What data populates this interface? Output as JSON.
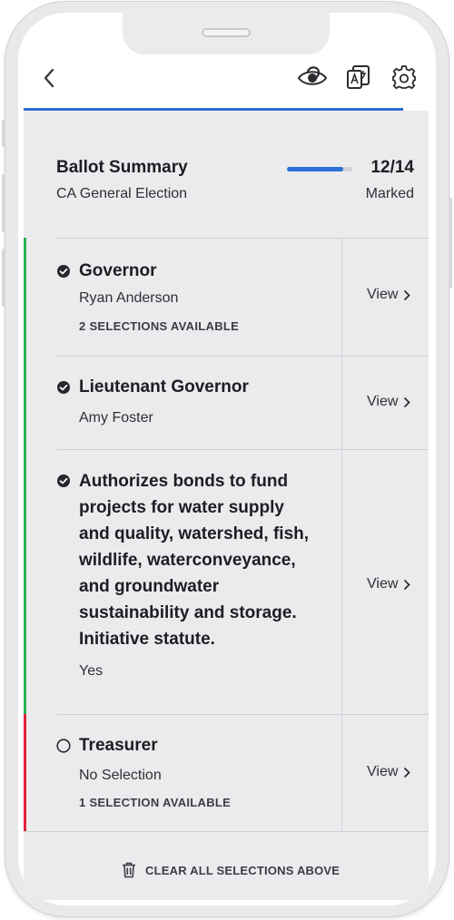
{
  "summary": {
    "title": "Ballot Summary",
    "election": "CA General Election",
    "count": "12/14",
    "marked_label": "Marked",
    "progress": 0.857
  },
  "contests": [
    {
      "title": "Governor",
      "selection": "Ryan Anderson",
      "availability": "2 SELECTIONS AVAILABLE",
      "status": "complete",
      "bar_color": "#27b350",
      "view_label": "View"
    },
    {
      "title": "Lieutenant Governor",
      "selection": "Amy Foster",
      "availability": "",
      "status": "complete",
      "bar_color": "#27b350",
      "view_label": "View"
    },
    {
      "title": "Authorizes bonds to fund projects for water supply and quality, watershed, fish, wildlife, waterconveyance, and groundwater sustainability and storage. Initiative statute.",
      "selection": "Yes",
      "availability": "",
      "status": "complete",
      "bar_color": "#27b350",
      "view_label": "View"
    },
    {
      "title": "Treasurer",
      "selection": "No Selection",
      "availability": "1 SELECTION AVAILABLE",
      "status": "incomplete",
      "bar_color": "#e0213a",
      "view_label": "View"
    }
  ],
  "footer": {
    "clear_label": "CLEAR ALL SELECTIONS ABOVE"
  },
  "header_icons": [
    "back-icon",
    "audio-visibility-icon",
    "language-translate-icon",
    "settings-icon"
  ],
  "colors": {
    "accent": "#2d6fd6",
    "complete": "#27b350",
    "incomplete": "#e0213a"
  }
}
